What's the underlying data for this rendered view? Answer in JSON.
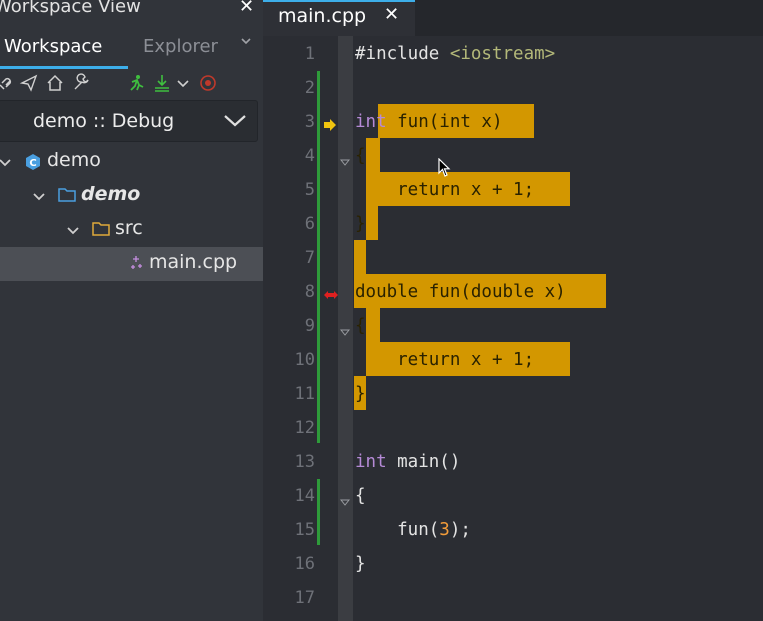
{
  "workspace": {
    "title": "Workspace View",
    "tabs": [
      {
        "label": "Workspace",
        "active": true
      },
      {
        "label": "Explorer",
        "active": false
      }
    ],
    "toolbar_icons": [
      "link-icon",
      "send-icon",
      "home-icon",
      "wrench-icon",
      "run-icon",
      "build-icon",
      "chevron-down-icon",
      "stop-icon"
    ],
    "config_label": "demo :: Debug",
    "tree": [
      {
        "label": "demo",
        "icon": "project-icon",
        "expanded": true
      },
      {
        "label": "demo",
        "icon": "folder-icon",
        "expanded": true,
        "bold": true
      },
      {
        "label": "src",
        "icon": "folder-icon",
        "expanded": true
      },
      {
        "label": "main.cpp",
        "icon": "file-icon",
        "selected": true
      }
    ]
  },
  "editor": {
    "tab_label": "main.cpp",
    "line_numbers": [
      "1",
      "2",
      "3",
      "4",
      "5",
      "6",
      "7",
      "8",
      "9",
      "10",
      "11",
      "12",
      "13",
      "14",
      "15",
      "16",
      "17"
    ],
    "lines": [
      {
        "segments": [
          {
            "t": "#include ",
            "c": ""
          },
          {
            "t": "<iostream>",
            "c": "inc"
          }
        ]
      },
      {
        "segments": []
      },
      {
        "segments": [
          {
            "t": "int",
            "c": "kw"
          },
          {
            "t": " fun(int x)",
            "c": ""
          }
        ]
      },
      {
        "segments": [
          {
            "t": "{",
            "c": ""
          }
        ]
      },
      {
        "segments": [
          {
            "t": "    return x + 1;",
            "c": ""
          }
        ]
      },
      {
        "segments": [
          {
            "t": "}",
            "c": ""
          }
        ]
      },
      {
        "segments": []
      },
      {
        "segments": [
          {
            "t": "double fun(double x)",
            "c": ""
          }
        ]
      },
      {
        "segments": [
          {
            "t": "{",
            "c": ""
          }
        ]
      },
      {
        "segments": [
          {
            "t": "    return x + 1;",
            "c": ""
          }
        ]
      },
      {
        "segments": [
          {
            "t": "}",
            "c": ""
          }
        ]
      },
      {
        "segments": []
      },
      {
        "segments": [
          {
            "t": "int",
            "c": "kw"
          },
          {
            "t": " main()",
            "c": ""
          }
        ]
      },
      {
        "segments": [
          {
            "t": "{",
            "c": ""
          }
        ]
      },
      {
        "segments": [
          {
            "t": "    fun(",
            "c": ""
          },
          {
            "t": "3",
            "c": "num"
          },
          {
            "t": ");",
            "c": ""
          }
        ]
      },
      {
        "segments": [
          {
            "t": "}",
            "c": ""
          }
        ]
      },
      {
        "segments": []
      }
    ],
    "highlight_color": "#d39700",
    "modified_bar_color": "#2e9b3a",
    "accent_color": "#3daee9",
    "markers": [
      {
        "line": 3,
        "type": "current-execution-arrow"
      },
      {
        "line": 8,
        "type": "breakpoint"
      }
    ],
    "fold_markers_lines": [
      4,
      9,
      14
    ]
  }
}
